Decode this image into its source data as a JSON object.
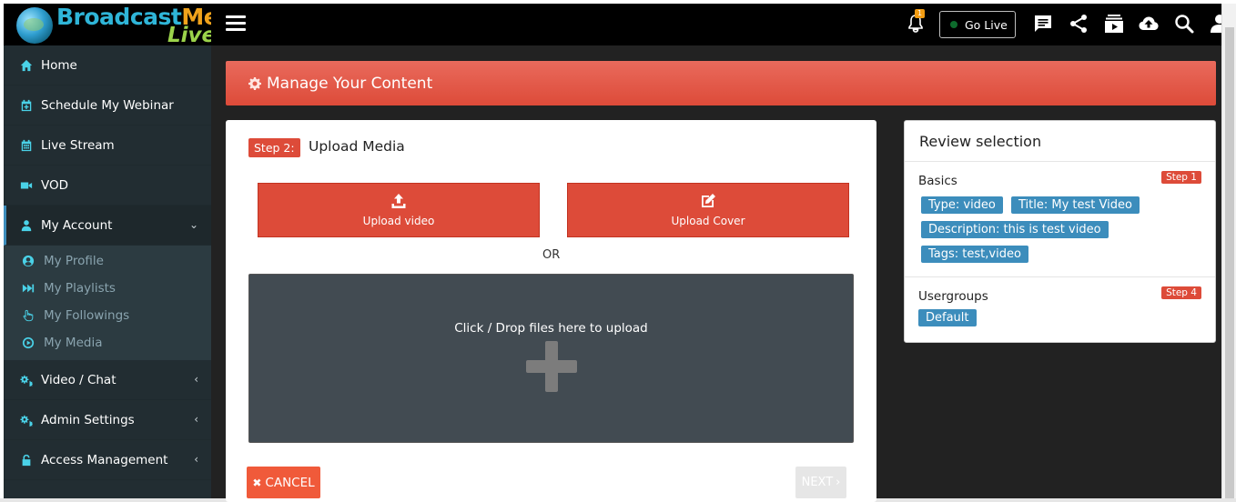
{
  "app": {
    "logo_part1": "Broadcast",
    "logo_part2": "Me",
    "logo_part3": "Live"
  },
  "sidebar": {
    "items": [
      {
        "label": "Home",
        "icon": "home-icon"
      },
      {
        "label": "Schedule My Webinar",
        "icon": "calendar-plus-icon"
      },
      {
        "label": "Live Stream",
        "icon": "calendar-icon"
      },
      {
        "label": "VOD",
        "icon": "video-camera-icon"
      },
      {
        "label": "My Account",
        "icon": "user-icon",
        "expanded": true
      },
      {
        "label": "Video / Chat",
        "icon": "cogs-icon"
      },
      {
        "label": "Admin Settings",
        "icon": "cogs-icon"
      },
      {
        "label": "Access Management",
        "icon": "lock-icon"
      }
    ],
    "submenu": [
      {
        "label": "My Profile",
        "icon": "user-circle-icon"
      },
      {
        "label": "My Playlists",
        "icon": "fast-forward-icon"
      },
      {
        "label": "My Followings",
        "icon": "hand-pointer-icon"
      },
      {
        "label": "My Media",
        "icon": "play-circle-icon"
      }
    ]
  },
  "topbar": {
    "notification_count": "1",
    "golive_label": "Go Live"
  },
  "banner": {
    "title": "Manage Your Content"
  },
  "upload": {
    "step_badge": "Step 2:",
    "step_title": "Upload Media",
    "upload_video_label": "Upload video",
    "upload_cover_label": "Upload Cover",
    "or_label": "OR",
    "drop_text": "Click / Drop files here to upload",
    "cancel_label": "CANCEL",
    "next_label": "NEXT"
  },
  "review": {
    "title": "Review selection",
    "basics_label": "Basics",
    "basics_step": "Step 1",
    "chips": {
      "type": "Type: video",
      "title": "Title: My test Video",
      "description": "Description: this is test video",
      "tags": "Tags: test,video"
    },
    "usergroups_label": "Usergroups",
    "usergroups_step": "Step 4",
    "usergroup_chip": "Default"
  },
  "colors": {
    "accent_red": "#dd4b39",
    "chip_blue": "#3c8dbc",
    "sidebar_bg": "#222d32",
    "icon_cyan": "#4ad2e8"
  }
}
